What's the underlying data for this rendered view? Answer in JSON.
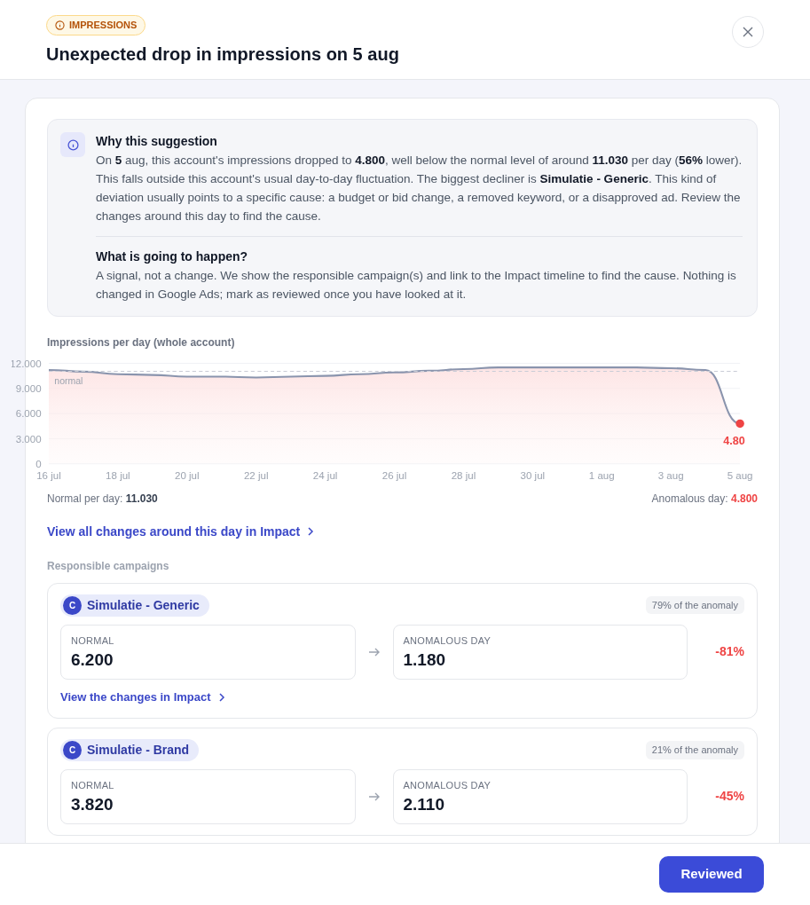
{
  "header": {
    "badge": "IMPRESSIONS",
    "title": "Unexpected drop in impressions on 5 aug"
  },
  "explanation": {
    "sections": [
      {
        "heading": "Why this suggestion",
        "body": "On **5** aug, this account's impressions dropped to **4.800**, well below the normal level of around **11.030** per day (**56%** lower). This falls outside this account's usual day-to-day fluctuation. The biggest decliner is **Simulatie - Generic**. This kind of deviation usually points to a specific cause: a budget or bid change, a removed keyword, or a disapproved ad. Review the changes around this day to find the cause."
      },
      {
        "heading": "What is going to happen?",
        "body": "A signal, not a change. We show the responsible campaign(s) and link to the Impact timeline to find the cause. Nothing is changed in Google Ads; mark as reviewed once you have looked at it."
      }
    ]
  },
  "chart": {
    "title": "Impressions per day (whole account)",
    "chart_data": {
      "type": "line",
      "categories": [
        "16 jul",
        null,
        "18 jul",
        null,
        "20 jul",
        null,
        "22 jul",
        null,
        "24 jul",
        null,
        "26 jul",
        null,
        "28 jul",
        null,
        "30 jul",
        null,
        "1 aug",
        null,
        "3 aug",
        null,
        "5 aug"
      ],
      "grid": true,
      "series": [
        {
          "line_style": "solid",
          "color": "#8a94ad",
          "values": [
            11.2,
            11.0,
            10.7,
            10.6,
            10.4,
            10.4,
            10.3,
            10.4,
            10.5,
            10.7,
            10.9,
            11.1,
            11.3,
            11.5,
            11.5,
            11.5,
            11.5,
            11.5,
            11.4,
            11.2,
            4.8
          ]
        },
        {
          "name": "normal",
          "line_style": "dashed",
          "color": "#c9ccd6",
          "values": [
            11.03,
            11.03,
            11.03,
            11.03,
            11.03,
            11.03,
            11.03,
            11.03,
            11.03,
            11.03,
            11.03,
            11.03,
            11.03,
            11.03,
            11.03,
            11.03,
            11.03,
            11.03,
            11.03,
            11.03,
            11.03
          ]
        }
      ],
      "ylim": [
        0,
        12
      ],
      "yticks": [
        {
          "value": 0,
          "label": "0"
        },
        {
          "value": 3,
          "label": "3.000"
        },
        {
          "value": 6,
          "label": "6.000"
        },
        {
          "value": 9,
          "label": "9.000"
        },
        {
          "value": 12,
          "label": "12.000"
        }
      ],
      "annotations": [
        {
          "x": "5 aug",
          "y": 4.8,
          "text": "4.80"
        }
      ]
    },
    "normal_label": "Normal per day:",
    "normal_value": "11.030",
    "anomaly_label": "Anomalous day:",
    "anomaly_value": "4.800"
  },
  "impact_link": "View all changes around this day in Impact",
  "campaigns_title": "Responsible campaigns",
  "campaigns": [
    {
      "avatar": "C",
      "name": "Simulatie - Generic",
      "share": "79% of the anomaly",
      "normal_label": "NORMAL",
      "normal": "6.200",
      "anomaly_label": "ANOMALOUS DAY",
      "anomaly": "1.180",
      "change": "-81%",
      "link": "View the changes in Impact"
    },
    {
      "avatar": "C",
      "name": "Simulatie - Brand",
      "share": "21% of the anomaly",
      "normal_label": "NORMAL",
      "normal": "3.820",
      "anomaly_label": "ANOMALOUS DAY",
      "anomaly": "2.110",
      "change": "-45%"
    }
  ],
  "footer": {
    "button": "Reviewed"
  }
}
